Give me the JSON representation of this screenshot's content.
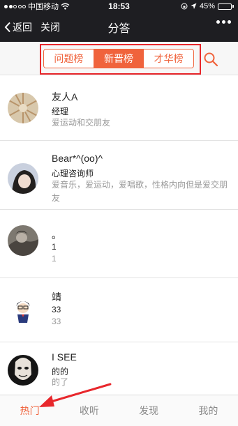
{
  "status_bar": {
    "carrier": "中国移动",
    "time": "18:53",
    "battery": "45%",
    "battery_level": 0.45
  },
  "nav": {
    "back_label": "返回",
    "close_label": "关闭",
    "title": "分答"
  },
  "tabs": [
    {
      "label": "问题榜",
      "active": false
    },
    {
      "label": "新晋榜",
      "active": true
    },
    {
      "label": "才华榜",
      "active": false
    }
  ],
  "list": [
    {
      "name": "友人A",
      "role": "经理",
      "desc": "爱运动和交朋友",
      "avatar_icon": "abstract-gold-avatar"
    },
    {
      "name": "Bear*^(oo)^",
      "role": "心理咨询师",
      "desc": "爱音乐，爱运动，爱唱歌，性格内向但是爱交朋友",
      "avatar_icon": "girl-photo-avatar"
    },
    {
      "name": "。",
      "role": "1",
      "desc": "1",
      "avatar_icon": "dark-photo-avatar"
    },
    {
      "name": "靖",
      "role": "33",
      "desc": "33",
      "avatar_icon": "cartoon-boy-avatar"
    },
    {
      "name": "I SEE",
      "role": "的的",
      "desc": "的了",
      "avatar_icon": "mask-avatar"
    }
  ],
  "tabbar": [
    {
      "label": "热门",
      "active": true
    },
    {
      "label": "收听",
      "active": false
    },
    {
      "label": "发现",
      "active": false
    },
    {
      "label": "我的",
      "active": false
    }
  ],
  "colors": {
    "accent": "#f0633c",
    "annotation": "#e8272c",
    "nav_bg": "#1e1e22"
  }
}
